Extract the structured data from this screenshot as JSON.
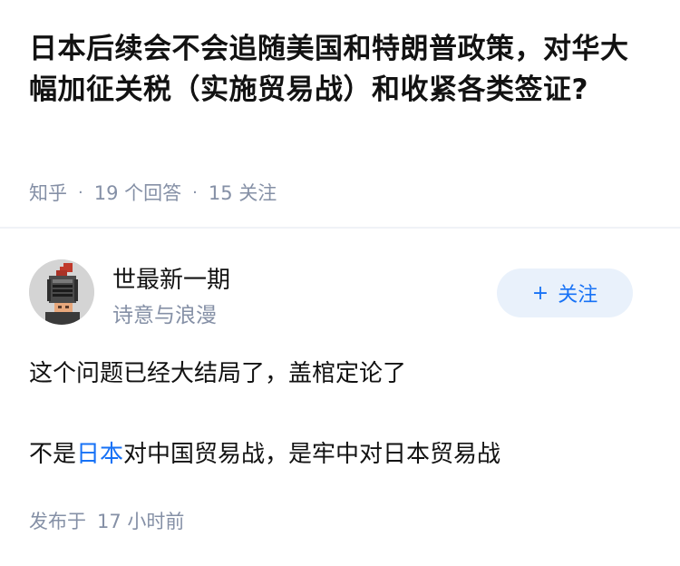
{
  "question": {
    "title": "日本后续会不会追随美国和特朗普政策，对华大幅加征关税（实施贸易战）和收紧各类签证?",
    "meta": {
      "source": "知乎",
      "answers_count": "19",
      "answers_label": "个回答",
      "followers_count": "15",
      "followers_label": "关注"
    }
  },
  "author": {
    "name": "世最新一期",
    "bio": "诗意与浪漫",
    "follow_label": "关注",
    "follow_icon": "plus-icon"
  },
  "answer": {
    "paragraph1": "这个问题已经大结局了，盖棺定论了",
    "paragraph2_prefix": "不是",
    "paragraph2_link": "日本",
    "paragraph2_suffix": "对中国贸易战，是牢中对日本贸易战"
  },
  "published": {
    "label": "发布于",
    "time": "17 小时前"
  },
  "colors": {
    "accent": "#1772f6",
    "muted": "#8590a6",
    "follow_bg": "#e9f1fb"
  }
}
